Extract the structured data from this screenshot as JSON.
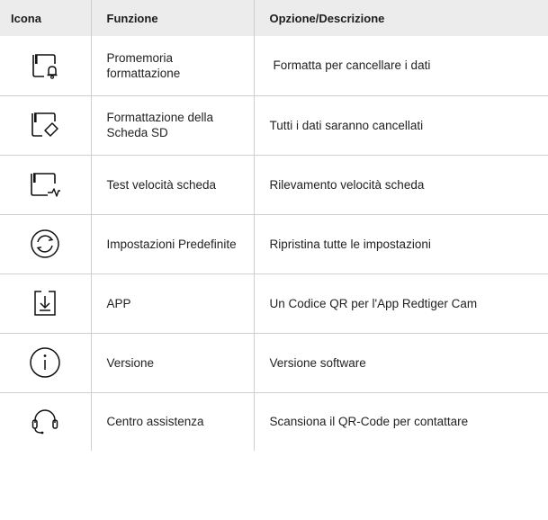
{
  "header": {
    "icon": "Icona",
    "function": "Funzione",
    "option": "Opzione/Descrizione"
  },
  "rows": [
    {
      "icon": "sd-card-bell-icon",
      "function": "Promemoria formattazione",
      "description": "Formatta per cancellare i dati"
    },
    {
      "icon": "sd-card-eraser-icon",
      "function": "Formattazione della Scheda SD",
      "description": "Tutti i dati saranno cancellati"
    },
    {
      "icon": "sd-card-pulse-icon",
      "function": "Test velocità scheda",
      "description": "Rilevamento velocità scheda"
    },
    {
      "icon": "reset-arrows-icon",
      "function": "Impostazioni Predefinite",
      "description": "Ripristina tutte le impostazioni"
    },
    {
      "icon": "download-box-icon",
      "function": "APP",
      "description": "Un Codice QR per l'App Redtiger Cam"
    },
    {
      "icon": "info-circle-icon",
      "function": "Versione",
      "description": "Versione software"
    },
    {
      "icon": "headset-icon",
      "function": "Centro assistenza",
      "description": "Scansiona il QR-Code per contattare"
    }
  ]
}
